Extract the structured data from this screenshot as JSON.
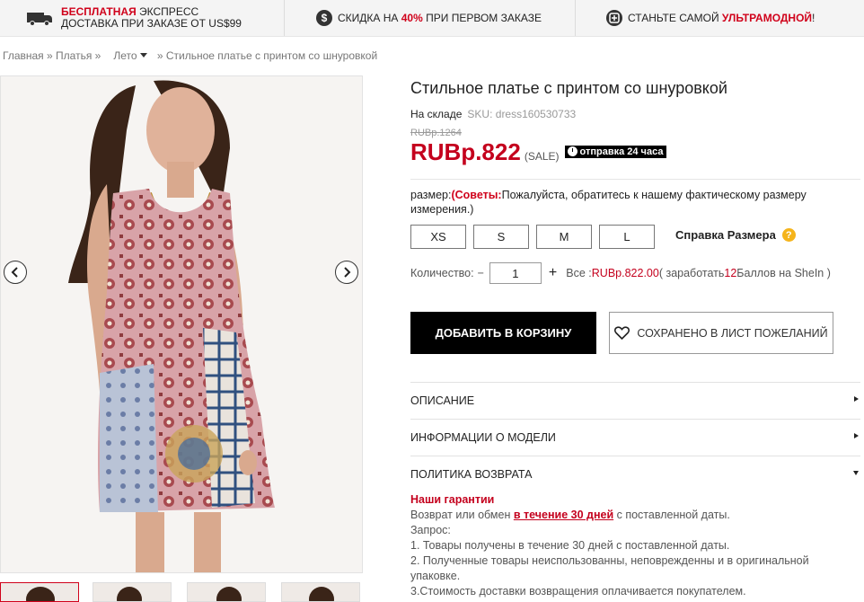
{
  "promo": {
    "p1_red": "БЕСПЛАТНАЯ",
    "p1_rest": " ЭКСПРЕСС",
    "p1_line2": "ДОСТАВКА ПРИ ЗАКАЗЕ ОТ US$99",
    "p2_pre": "СКИДКА НА ",
    "p2_red": "40%",
    "p2_post": " ПРИ ПЕРВОМ ЗАКАЗЕ",
    "p2_icon": "$",
    "p3_pre": "СТАНЬТЕ САМОЙ ",
    "p3_red": "УЛЬТРАМОДНОЙ",
    "p3_post": "!"
  },
  "breadcrumb": {
    "home": "Главная",
    "sep1": " » ",
    "dresses": "Платья",
    "sep2": " »",
    "summer": "Лето",
    "sep3": " » ",
    "current": "Стильное платье с принтом со шнуровкой"
  },
  "product": {
    "title": "Стильное платье с принтом со шнуровкой",
    "stock": "На складе",
    "sku": "SKU: dress160530733",
    "old_price": "RUBp.1264",
    "price": "RUBp.822",
    "sale": "(SALE)",
    "ship_badge": "отправка 24 часа"
  },
  "size": {
    "label": "размер:",
    "tips_open": "(",
    "tips": "Советы:",
    "tips_text": "Пожалуйста, обратитесь к нашему фактическому размеру измерения.)",
    "options": [
      "XS",
      "S",
      "M",
      "L"
    ],
    "help": "Справка Размера",
    "help_icon": "?"
  },
  "quantity": {
    "label": "Количество:",
    "minus": "−",
    "value": "1",
    "plus": "+",
    "total_label": "Все : ",
    "total": "RUBp.822.00",
    "earn_pre": " ( заработать ",
    "earn_points": "12",
    "earn_post": " Баллов на SheIn )"
  },
  "actions": {
    "add_to_cart": "ДОБАВИТЬ В КОРЗИНУ",
    "wishlist": "СОХРАНЕНО В ЛИСТ ПОЖЕЛАНИЙ"
  },
  "accordion": {
    "description": "Описание",
    "model": "Информации о модели",
    "returns": "Политика возврата"
  },
  "policy": {
    "title": "Наши гарантии",
    "line1_pre": "Возврат или обмен ",
    "line1_hl": "в течение 30 дней",
    "line1_post": " с поставленной даты.",
    "line2": "Запрос:",
    "line3": "1. Товары получены в течение 30 дней с поставленной даты.",
    "line4": "2. Полученные товары неиспользованны, неповрежденны и в оригинальной упаковке.",
    "line5": "3.Стоимость доставки возвращения оплачивается покупателем."
  },
  "colors": {
    "accent_red": "#c4001d",
    "promo_red": "#d0021b",
    "button_black": "#000000",
    "help_yellow": "#f5b41b"
  }
}
